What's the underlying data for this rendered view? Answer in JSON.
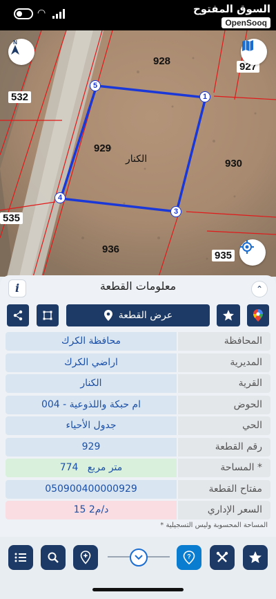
{
  "watermark": {
    "arabic": "السوق المفتوح",
    "english": "OpenSooq"
  },
  "map": {
    "parcels": [
      "928",
      "927",
      "532",
      "929",
      "930",
      "535",
      "936",
      "935"
    ],
    "village_label": "الكنار",
    "vertices": [
      "5",
      "1",
      "4",
      "3"
    ]
  },
  "panel": {
    "title": "معلومات القطعة",
    "info_label": "i",
    "show_parcel_label": "عرض القطعة",
    "rows": [
      {
        "label": "المحافظة",
        "value": "محافظة الكرك"
      },
      {
        "label": "المديرية",
        "value": "اراضي الكرك"
      },
      {
        "label": "القرية",
        "value": "الكنار"
      },
      {
        "label": "الحوض",
        "value": "ام حبكة واللذوعية - 004"
      },
      {
        "label": "الحي",
        "value": "جدول الأحياء"
      },
      {
        "label": "رقم القطعة",
        "value": "929"
      },
      {
        "label": "المساحة *",
        "value": "774   متر مربع"
      },
      {
        "label": "مفتاح القطعة",
        "value": "050900400000929"
      },
      {
        "label": "السعر الإداري",
        "value": "15 د/م2"
      }
    ],
    "note": "* المساحة المحسوبة وليس التسجيلية"
  },
  "colors": {
    "primary": "#1d3a66",
    "accent": "#0b7dd0",
    "parcel_outline": "#1a38d8",
    "boundary": "#e01a1a"
  },
  "icons": [
    "north-arrow-icon",
    "map-layers-icon",
    "locate-icon",
    "info-icon",
    "chevron-up-icon",
    "share-icon",
    "polygon-icon",
    "location-pin-icon",
    "star-icon",
    "google-maps-icon",
    "list-icon",
    "search-icon",
    "add-pin-icon",
    "chevron-down-icon",
    "help-icon",
    "tools-icon",
    "home-star-icon"
  ]
}
